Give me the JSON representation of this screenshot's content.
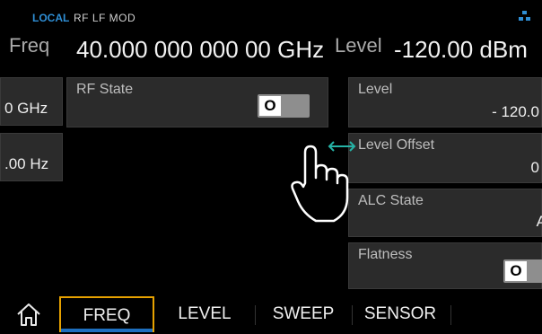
{
  "status": {
    "mode": "LOCAL",
    "flags": "RF  LF  MOD",
    "network_icon": "network-icon"
  },
  "header": {
    "freq_label": "Freq",
    "freq_value": "40.000 000 000 00 GHz",
    "level_label": "Level",
    "level_value": "-120.00 dBm"
  },
  "left_cards": [
    "0 GHz",
    ".00 Hz"
  ],
  "rf_state": {
    "label": "RF State",
    "toggle": "O"
  },
  "right_panels": {
    "level": {
      "label": "Level",
      "value": "- 120.0"
    },
    "level_offset": {
      "label": "Level Offset",
      "value": "0"
    },
    "alc_state": {
      "label": "ALC State",
      "value": "A"
    },
    "flatness": {
      "label": "Flatness",
      "toggle": "O"
    }
  },
  "tabs": [
    "FREQ",
    "LEVEL",
    "SWEEP",
    "SENSOR"
  ],
  "colors": {
    "accent_blue": "#2f8fd6",
    "active_tab_border": "#e6a100",
    "swipe_arrow": "#26b3a6"
  }
}
